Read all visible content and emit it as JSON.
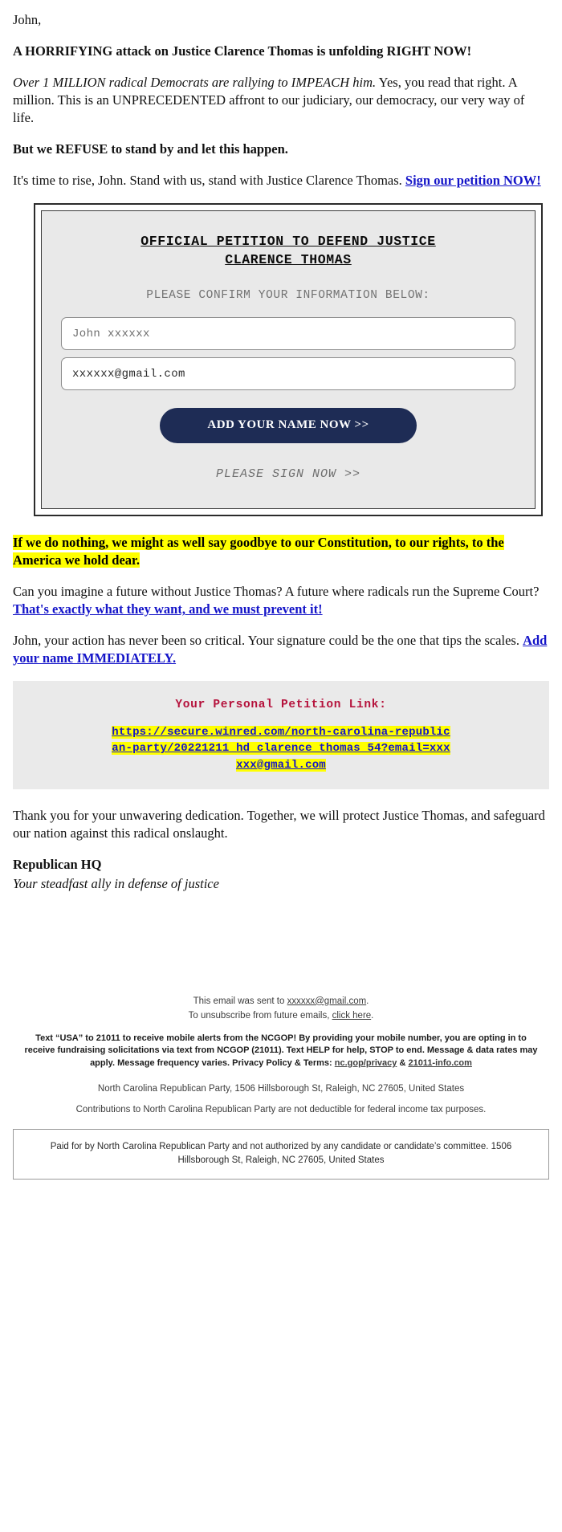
{
  "greeting": "John,",
  "headline": "A HORRIFYING attack on Justice Clarence Thomas is unfolding RIGHT NOW!",
  "lede_italic": "Over 1 MILLION radical Democrats are rallying to IMPEACH him.",
  "lede_rest": " Yes, you read that right. A million. This is an UNPRECEDENTED affront to our judiciary, our democracy, our very way of life.",
  "refuse_line": "But we REFUSE to stand by and let this happen.",
  "rise_text": "It's time to rise, John. Stand with us, stand with Justice Clarence Thomas. ",
  "rise_link": "Sign our petition NOW!",
  "petition": {
    "title_line1": "OFFICIAL PETITION TO DEFEND JUSTICE",
    "title_line2": "CLARENCE THOMAS",
    "subtitle": "PLEASE CONFIRM YOUR INFORMATION BELOW:",
    "name_value": "John xxxxxx",
    "name_placeholder": "John xxxxxx",
    "email_value": "xxxxxx@gmail.com",
    "email_placeholder": "xxxxxx@gmail.com",
    "cta_label": "ADD YOUR NAME NOW >>",
    "footer_note": "PLEASE SIGN NOW >>",
    "cta_color": "#1e2c55",
    "panel_color": "#e9e9e9"
  },
  "highlight_warning": "If we do nothing, we might as well say goodbye to our Constitution, to our rights, to the America we hold dear.",
  "imagine_text": "Can you imagine a future without Justice Thomas? A future where radicals run the Supreme Court? ",
  "imagine_link": "That's exactly what they want, and we must prevent it!",
  "critical_text": "John, your action has never been so critical. Your signature could be the one that tips the scales. ",
  "critical_link": "Add your name IMMEDIATELY.",
  "personal_link": {
    "heading": "Your Personal Petition Link:",
    "url_line1": "https://secure.winred.com/north-carolina-republican-",
    "url_line2": "party/20221211_hd_clarence_thomas_54?",
    "url_line3": "email=xxxxxx@gmail.com",
    "heading_color": "#b5123c",
    "highlight_color": "#ffff00"
  },
  "closing": "Thank you for your unwavering dedication. Together, we will protect Justice Thomas, and safeguard our nation against this radical onslaught.",
  "signature_name": "Republican HQ",
  "signature_tagline": "Your steadfast ally in defense of justice",
  "footer": {
    "sent_prefix": "This email was sent to ",
    "sent_email": "xxxxxx@gmail.com",
    "sent_suffix": ".",
    "unsub_prefix": "To unsubscribe from future emails, ",
    "unsub_link": "click here",
    "unsub_suffix": ".",
    "sms_text": "Text “USA” to 21011 to receive mobile alerts from the NCGOP! By providing your mobile number, you are opting in to receive fundraising solicitations via text from NCGOP (21011). Text HELP for help, STOP to end. Message & data rates may apply. Message frequency varies. Privacy Policy & Terms: ",
    "sms_link1": "nc.gop/privacy",
    "sms_amp": " & ",
    "sms_link2": "21011-info.com",
    "address": "North Carolina Republican Party, 1506 Hillsborough St, Raleigh, NC 27605, United States",
    "contributions": "Contributions to North Carolina Republican Party are not deductible for federal income tax purposes.",
    "disclaimer": "Paid for by North Carolina Republican Party and not authorized by any candidate or candidate’s committee. 1506 Hillsborough St, Raleigh, NC 27605, United States"
  }
}
